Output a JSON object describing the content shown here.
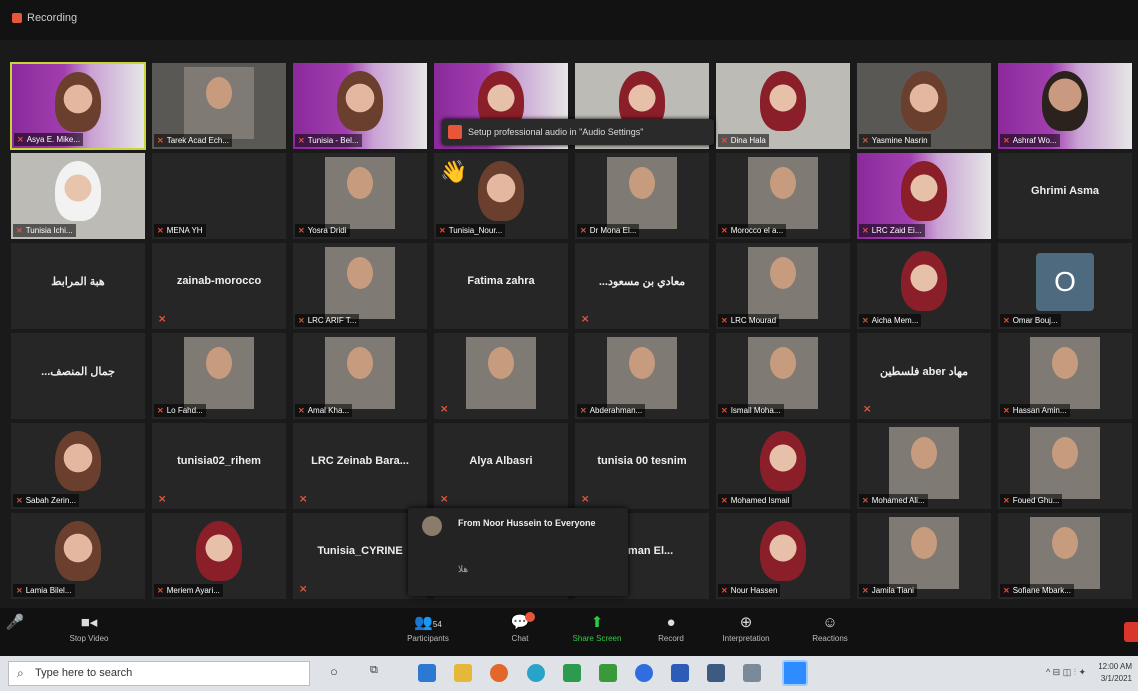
{
  "window": {
    "recording_label": "Recording"
  },
  "notification": {
    "text": "Setup professional audio in \"Audio Settings\""
  },
  "tiles": [
    {
      "name": "Asya E. Mike...",
      "style": "active banner",
      "face": "face"
    },
    {
      "name": "Tarek Acad Ech...",
      "style": "photo",
      "face": "pic"
    },
    {
      "name": "Tunisia - Bel...",
      "style": "banner",
      "face": "face"
    },
    {
      "name": "",
      "style": "banner",
      "face": "face hijab"
    },
    {
      "name": "",
      "style": "light",
      "face": "face hijab"
    },
    {
      "name": "Dina Hala",
      "style": "light",
      "face": "face hijab"
    },
    {
      "name": "Yasmine Nasrin",
      "style": "photo",
      "face": "face"
    },
    {
      "name": "Ashraf Wo...",
      "style": "banner",
      "face": "face man"
    },
    {
      "name": "Tunisia Ichi...",
      "style": "light",
      "face": "face white"
    },
    {
      "name": "MENA YH",
      "style": "",
      "face": "",
      "muteOnly": false
    },
    {
      "name": "Yosra Dridi",
      "style": "",
      "face": "pic"
    },
    {
      "name": "Tunisia_Nour...",
      "style": "",
      "face": "face",
      "wave": true
    },
    {
      "name": "Dr Mona El...",
      "style": "",
      "face": "pic"
    },
    {
      "name": "Morocco el a...",
      "style": "",
      "face": "pic"
    },
    {
      "name": "LRC Zaid Ei...",
      "style": "banner",
      "face": "face hijab"
    },
    {
      "center": "Ghrimi Asma",
      "style": ""
    },
    {
      "center": "هبة المرابط",
      "style": ""
    },
    {
      "center": "zainab-morocco",
      "style": "",
      "muteOnly": true
    },
    {
      "name": "LRC ARIF T...",
      "style": "",
      "face": "pic"
    },
    {
      "center": "Fatima zahra",
      "style": ""
    },
    {
      "center": "...معادي بن مسعود",
      "style": "",
      "muteOnly": true
    },
    {
      "name": "LRC Mourad",
      "style": "",
      "face": "pic"
    },
    {
      "name": "Aicha Mem...",
      "style": "",
      "face": "face hijab"
    },
    {
      "name": "Omar Bouj...",
      "style": "",
      "avatar": "O"
    },
    {
      "center": "...جمال المنصف",
      "style": ""
    },
    {
      "name": "Lo Fahd...",
      "style": "",
      "face": "pic"
    },
    {
      "name": "Amal Kha...",
      "style": "",
      "face": "pic"
    },
    {
      "name": "",
      "style": "",
      "face": "pic",
      "muteOnly": true
    },
    {
      "name": "Abderahman...",
      "style": "",
      "face": "pic"
    },
    {
      "name": "Ismail Moha...",
      "style": "",
      "face": "pic"
    },
    {
      "center": "فلسطين aber مهاد",
      "style": "",
      "muteOnly": true
    },
    {
      "name": "Hassan Amin...",
      "style": "",
      "face": "pic"
    },
    {
      "name": "Sabah Zerin...",
      "style": "",
      "face": "face"
    },
    {
      "center": "tunisia02_rihem",
      "style": "",
      "muteOnly": true
    },
    {
      "center": "LRC Zeinab Bara...",
      "style": "",
      "muteOnly": true
    },
    {
      "center": "Alya Albasri",
      "style": "",
      "muteOnly": true
    },
    {
      "center": "tunisia 00 tesnim",
      "style": "",
      "muteOnly": true
    },
    {
      "name": "Mohamed Ismail",
      "style": "",
      "face": "face hijab"
    },
    {
      "name": "Mohamed Ali...",
      "style": "",
      "face": "pic"
    },
    {
      "name": "Foued Ghu...",
      "style": "",
      "face": "pic"
    },
    {
      "name": "Lamia Bilel...",
      "style": "",
      "face": "face"
    },
    {
      "name": "Meriem Ayari...",
      "style": "",
      "face": "face hijab"
    },
    {
      "center": "Tunisia_CYRINE",
      "style": "",
      "muteOnly": true
    },
    {
      "center": "",
      "style": ""
    },
    {
      "center": "rahman El...",
      "style": "",
      "muteOnly": true
    },
    {
      "name": "Nour Hassen",
      "style": "",
      "face": "face hijab"
    },
    {
      "name": "Jamila Tiani",
      "style": "",
      "face": "pic"
    },
    {
      "name": "Sofiane Mbark...",
      "style": "",
      "face": "pic"
    }
  ],
  "chat_popup": {
    "from": "From Noor Hussein to Everyone",
    "message": "هلا"
  },
  "toolbar": {
    "video_label": "Stop Video",
    "participants_label": "Participants",
    "participants_count": "54",
    "chat_label": "Chat",
    "share_label": "Share Screen",
    "record_label": "Record",
    "interpretation_label": "Interpretation",
    "reactions_label": "Reactions"
  },
  "taskbar": {
    "search_placeholder": "Type here to search",
    "time": "12:00 AM",
    "date": "3/1/2021"
  },
  "colors": {
    "accent": "#2ecc40",
    "mute": "#e8563a",
    "active_border": "#c9d63b"
  }
}
